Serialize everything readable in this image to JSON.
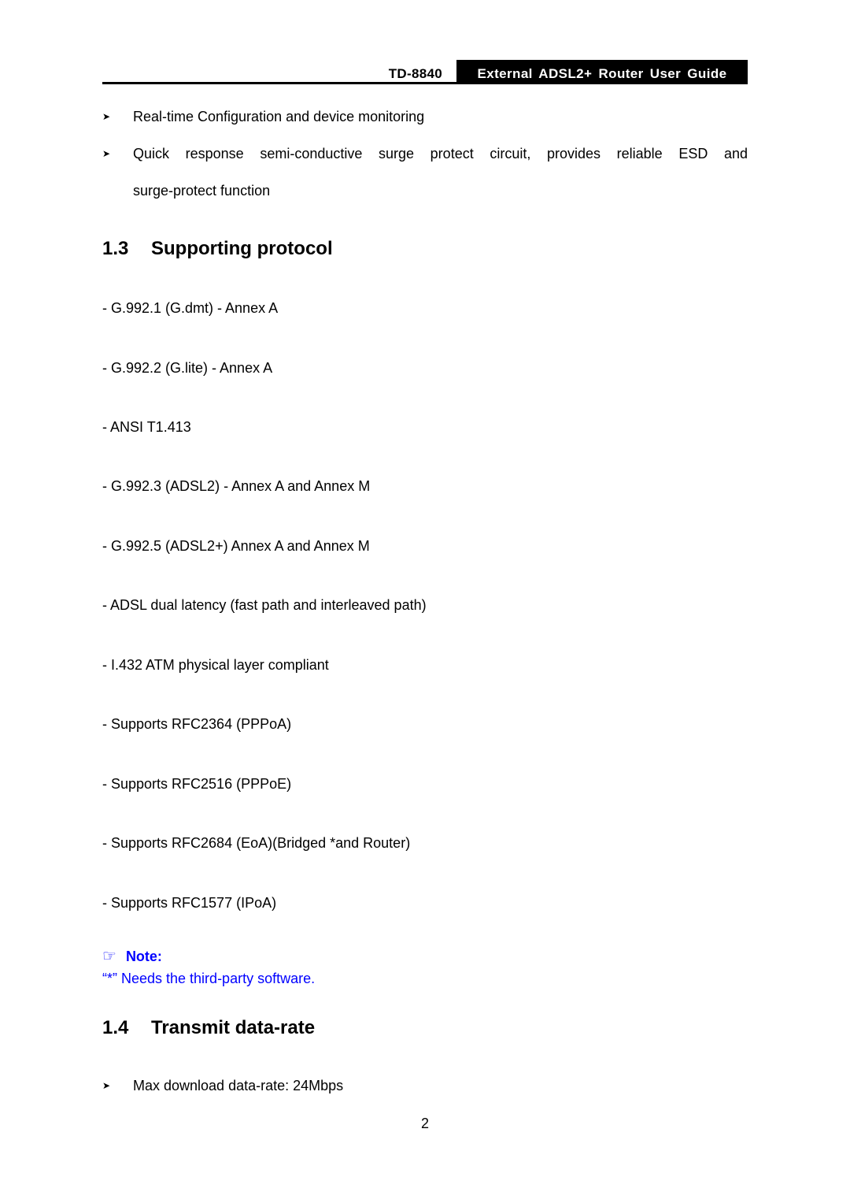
{
  "header": {
    "model": "TD-8840",
    "guide_title": "External ADSL2+ Router User Guide"
  },
  "intro_bullets": [
    {
      "icon": "arrow-bullet-icon",
      "text": "Real-time Configuration and device monitoring"
    },
    {
      "icon": "arrow-bullet-icon",
      "text_line1": "Quick response semi-conductive surge protect circuit, provides reliable ESD and",
      "text_line2": "surge-protect function"
    }
  ],
  "section_1_3": {
    "number": "1.3",
    "title": "Supporting protocol",
    "items": [
      "- G.992.1 (G.dmt) - Annex A",
      "- G.992.2 (G.lite) - Annex A",
      "- ANSI T1.413",
      "- G.992.3 (ADSL2) - Annex A and Annex M",
      "- G.992.5 (ADSL2+) Annex A and Annex M",
      "- ADSL dual latency (fast path and interleaved path)",
      "- I.432 ATM physical layer compliant",
      "- Supports RFC2364 (PPPoA)",
      "- Supports RFC2516 (PPPoE)",
      "- Supports RFC2684 (EoA)(Bridged *and Router)",
      "- Supports RFC1577 (IPoA)"
    ]
  },
  "note": {
    "icon": "pointing-hand-icon",
    "label": "Note:",
    "text": "“*” Needs the third-party software.",
    "color": "#0000ff"
  },
  "section_1_4": {
    "number": "1.4",
    "title": "Transmit data-rate",
    "bullets": [
      {
        "icon": "arrow-bullet-icon",
        "text": "Max download data-rate: 24Mbps"
      }
    ]
  },
  "page_number": "2"
}
